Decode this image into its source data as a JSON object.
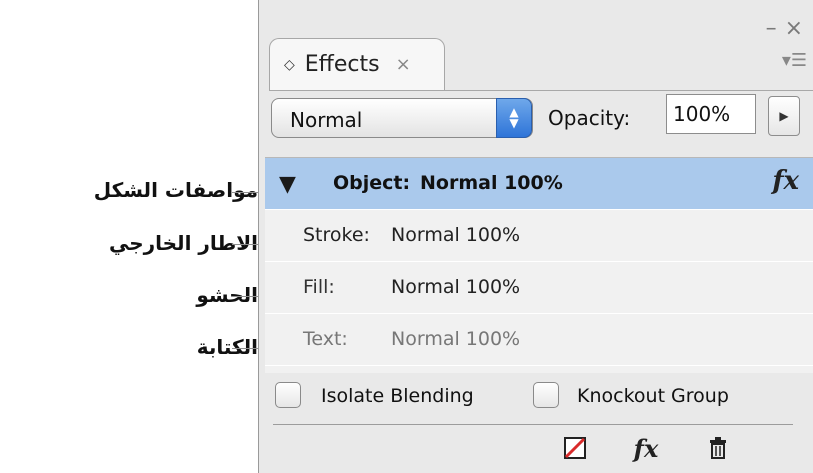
{
  "panel": {
    "tab_label": "Effects",
    "tab_diamond": "◇",
    "tab_close": "×",
    "window_controls": [
      "–",
      "×"
    ],
    "panel_menu": "▾☰",
    "blend_mode": "Normal",
    "opacity_label": "Opacity:",
    "opacity_value": "100%",
    "opacity_button": "▶"
  },
  "items": [
    {
      "key": "Object:",
      "value": "Normal 100%",
      "expand_icon": "▼",
      "fx": "fx"
    },
    {
      "key": "Stroke:",
      "value": "Normal 100%"
    },
    {
      "key": "Fill:",
      "value": "Normal 100%"
    },
    {
      "key": "Text:",
      "value": "Normal 100%"
    }
  ],
  "checks": {
    "isolate_label": "Isolate Blending",
    "knockout_label": "Knockout Group"
  },
  "bottom_icons": [
    "clear-effects-icon",
    "fx-menu-icon",
    "delete-icon"
  ],
  "bottom_fx_label": "fx",
  "annotations": [
    "مواصفات الشكل",
    "الاطار الخارجي",
    "الحشو",
    "الكتابة"
  ],
  "colors": {
    "selection": "#aac9ec",
    "stepper_blue": "#2e74d8",
    "panel_bg": "#e9e9e9",
    "clear_effects_red": "#d92b2b"
  }
}
